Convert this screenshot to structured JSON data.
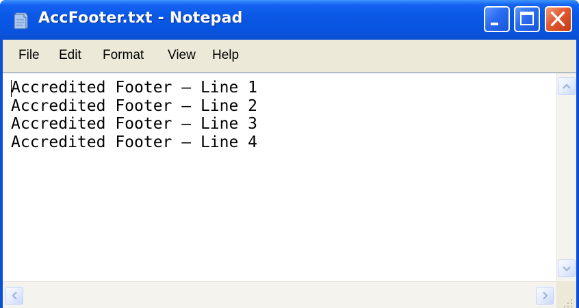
{
  "window": {
    "title": "AccFooter.txt - Notepad",
    "icon": "notepad-icon"
  },
  "title_buttons": {
    "minimize_icon": "minimize-icon",
    "maximize_icon": "maximize-icon",
    "close_icon": "close-icon"
  },
  "menu": {
    "items": [
      {
        "label": "File"
      },
      {
        "label": "Edit"
      },
      {
        "label": "Format"
      },
      {
        "label": "View"
      },
      {
        "label": "Help"
      }
    ]
  },
  "document": {
    "lines": [
      "Accredited Footer – Line 1",
      "Accredited Footer – Line 2",
      "Accredited Footer – Line 3",
      "Accredited Footer – Line 4"
    ]
  },
  "colors": {
    "titlebar": "#0a58e6",
    "menubar": "#ece9d8",
    "close_button": "#e05a32",
    "scrollbar": "#f4f3ee"
  }
}
